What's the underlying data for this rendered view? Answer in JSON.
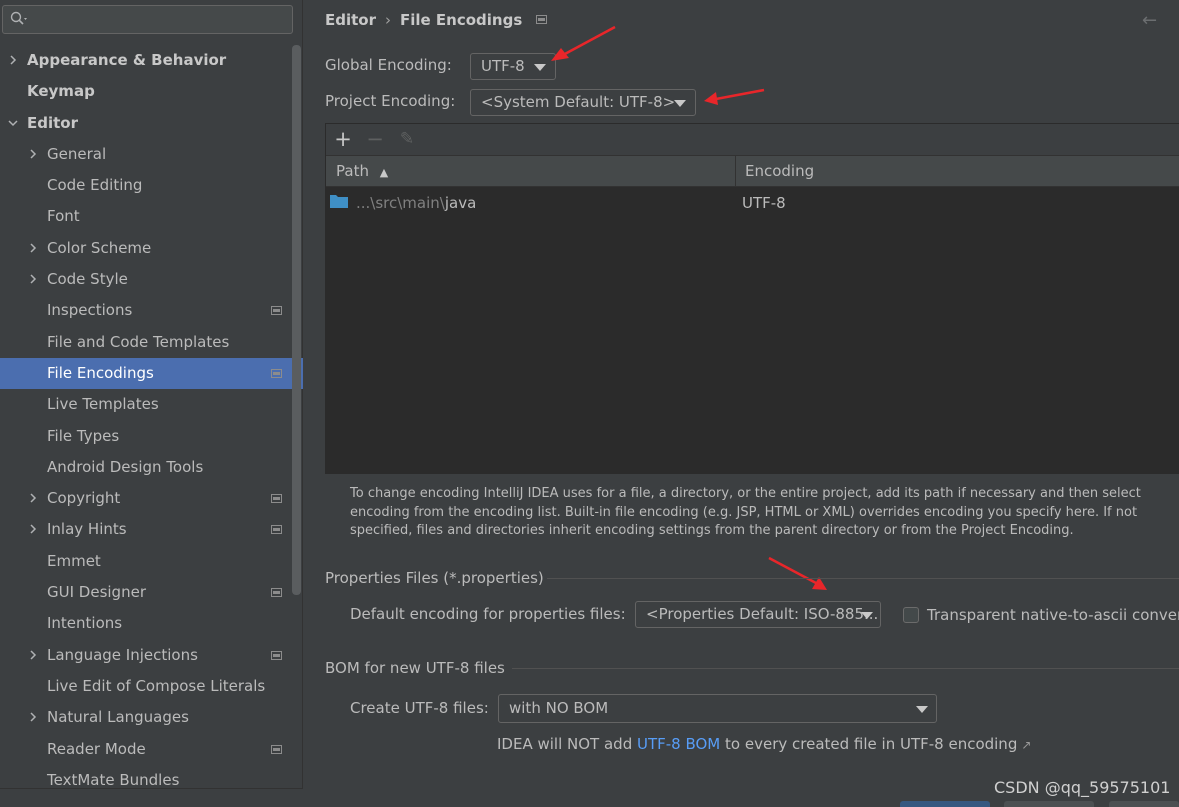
{
  "search": {
    "placeholder": ""
  },
  "sidebar": {
    "items": [
      {
        "label": "Appearance & Behavior",
        "level": 0,
        "expandable": true,
        "expanded": false,
        "bold": true,
        "project": false
      },
      {
        "label": "Keymap",
        "level": 0,
        "expandable": false,
        "bold": true,
        "project": false
      },
      {
        "label": "Editor",
        "level": 0,
        "expandable": true,
        "expanded": true,
        "bold": true,
        "project": false
      },
      {
        "label": "General",
        "level": 1,
        "expandable": true,
        "expanded": false,
        "project": false
      },
      {
        "label": "Code Editing",
        "level": 1,
        "expandable": false,
        "project": false
      },
      {
        "label": "Font",
        "level": 1,
        "expandable": false,
        "project": false
      },
      {
        "label": "Color Scheme",
        "level": 1,
        "expandable": true,
        "expanded": false,
        "project": false
      },
      {
        "label": "Code Style",
        "level": 1,
        "expandable": true,
        "expanded": false,
        "project": false
      },
      {
        "label": "Inspections",
        "level": 1,
        "expandable": false,
        "project": true
      },
      {
        "label": "File and Code Templates",
        "level": 1,
        "expandable": false,
        "project": false
      },
      {
        "label": "File Encodings",
        "level": 1,
        "expandable": false,
        "project": true,
        "selected": true
      },
      {
        "label": "Live Templates",
        "level": 1,
        "expandable": false,
        "project": false
      },
      {
        "label": "File Types",
        "level": 1,
        "expandable": false,
        "project": false
      },
      {
        "label": "Android Design Tools",
        "level": 1,
        "expandable": false,
        "project": false
      },
      {
        "label": "Copyright",
        "level": 1,
        "expandable": true,
        "expanded": false,
        "project": true
      },
      {
        "label": "Inlay Hints",
        "level": 1,
        "expandable": true,
        "expanded": false,
        "project": true
      },
      {
        "label": "Emmet",
        "level": 1,
        "expandable": false,
        "project": false
      },
      {
        "label": "GUI Designer",
        "level": 1,
        "expandable": false,
        "project": true
      },
      {
        "label": "Intentions",
        "level": 1,
        "expandable": false,
        "project": false
      },
      {
        "label": "Language Injections",
        "level": 1,
        "expandable": true,
        "expanded": false,
        "project": true
      },
      {
        "label": "Live Edit of Compose Literals",
        "level": 1,
        "expandable": false,
        "project": false
      },
      {
        "label": "Natural Languages",
        "level": 1,
        "expandable": true,
        "expanded": false,
        "project": false
      },
      {
        "label": "Reader Mode",
        "level": 1,
        "expandable": false,
        "project": true
      },
      {
        "label": "TextMate Bundles",
        "level": 1,
        "expandable": false,
        "project": false
      }
    ]
  },
  "header": {
    "breadcrumb_parent": "Editor",
    "breadcrumb_sep": "›",
    "breadcrumb_current": "File Encodings",
    "back_arrow": "←"
  },
  "encoding": {
    "global_label": "Global Encoding:",
    "global_value": "UTF-8",
    "project_label": "Project Encoding:",
    "project_value": "<System Default: UTF-8>"
  },
  "table": {
    "toolbar": {
      "add": "+",
      "remove": "−",
      "edit": "✎"
    },
    "columns": [
      "Path",
      "Encoding"
    ],
    "sort_indicator": "▲",
    "rows": [
      {
        "path_prefix": "...\\src\\main\\",
        "path_name": "java",
        "encoding": "UTF-8"
      }
    ]
  },
  "info_text": "To change encoding IntelliJ IDEA uses for a file, a directory, or the entire project, add its path if necessary and then select encoding from the encoding list. Built-in file encoding (e.g. JSP, HTML or XML) overrides encoding you specify here. If not specified, files and directories inherit encoding settings from the parent directory or from the Project Encoding.",
  "properties": {
    "title": "Properties Files (*.properties)",
    "default_label": "Default encoding for properties files:",
    "default_value": "<Properties Default: ISO-885...",
    "transparent_label": "Transparent native-to-ascii conversion",
    "transparent_checked": false
  },
  "bom": {
    "title": "BOM for new UTF-8 files",
    "create_label": "Create UTF-8 files:",
    "create_value": "with NO BOM",
    "note_prefix": "IDEA will NOT add ",
    "note_link": "UTF-8 BOM",
    "note_suffix": " to every created file in UTF-8 encoding",
    "note_arrow": "↗"
  },
  "watermark": "CSDN @qq_59575101",
  "colors": {
    "selection": "#4b6eaf",
    "link": "#589df6",
    "annotation_arrow": "#e8262a",
    "folder": "#3f8fc5"
  }
}
